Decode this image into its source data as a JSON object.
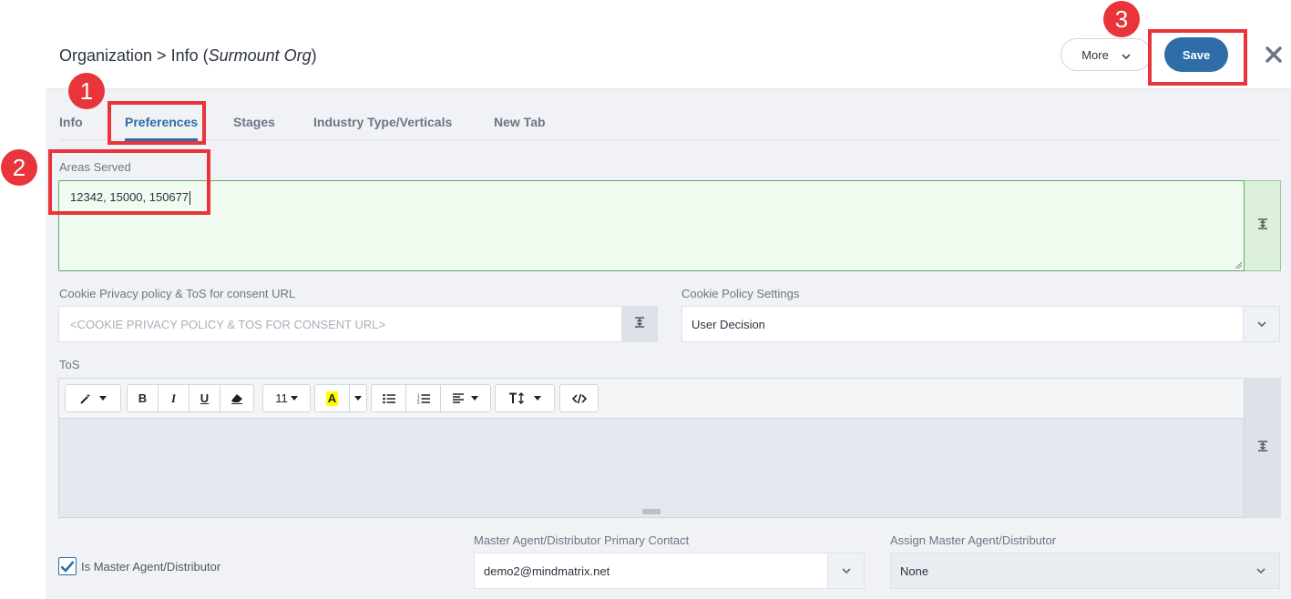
{
  "header": {
    "title_prefix": "Organization > Info (",
    "title_org": "Surmount Org",
    "title_suffix": ")",
    "more_label": "More",
    "save_label": "Save"
  },
  "tabs": [
    {
      "label": "Info",
      "active": false
    },
    {
      "label": "Preferences",
      "active": true
    },
    {
      "label": "Stages",
      "active": false
    },
    {
      "label": "Industry Type/Verticals",
      "active": false
    },
    {
      "label": "New Tab",
      "active": false
    }
  ],
  "areas_served": {
    "label": "Areas Served",
    "value": "12342, 15000, 150677"
  },
  "cookie_url": {
    "label": "Cookie Privacy policy & ToS for consent URL",
    "placeholder": "<COOKIE PRIVACY POLICY & TOS FOR CONSENT URL>"
  },
  "cookie_policy": {
    "label": "Cookie Policy Settings",
    "value": "User Decision"
  },
  "tos": {
    "label": "ToS",
    "font_size": "11"
  },
  "master_agent": {
    "checkbox_label": "Is Master Agent/Distributor",
    "checked": true,
    "primary_contact_label": "Master Agent/Distributor Primary Contact",
    "primary_contact_value": "demo2@mindmatrix.net",
    "assign_label": "Assign Master Agent/Distributor",
    "assign_value": "None"
  },
  "annotations": [
    "1",
    "2",
    "3"
  ],
  "colors": {
    "accent": "#2e6da8",
    "annotation": "#e8343a",
    "success_bg": "#f0fcf0"
  }
}
